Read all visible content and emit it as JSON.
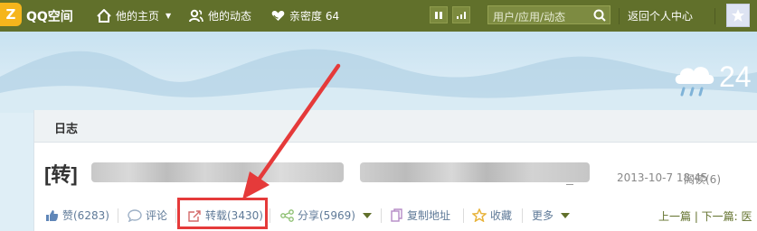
{
  "topbar": {
    "logo_glyph": "Z",
    "brand": "QQ空间",
    "nav_home": "他的主页",
    "nav_activity": "他的动态",
    "nav_intimacy": "亲密度 64",
    "search_placeholder": "用户/应用/动态",
    "return_link": "返回个人中心"
  },
  "weather": {
    "temperature": "24"
  },
  "panel": {
    "title": "日志"
  },
  "post": {
    "title_prefix": "[转]",
    "date": "2013-10-7 18:45",
    "reads": "阅读(6)"
  },
  "actions": {
    "like": "赞(6283)",
    "comment": "评论",
    "repost": "转载(3430)",
    "share": "分享(5969)",
    "copy_link": "复制地址",
    "favorite": "收藏",
    "more": "更多",
    "prev_next": "上一篇 | 下一篇: 医"
  },
  "colors": {
    "topbar": "#61702b",
    "accent_link": "#5f7a98",
    "highlight": "#e53a3a"
  }
}
